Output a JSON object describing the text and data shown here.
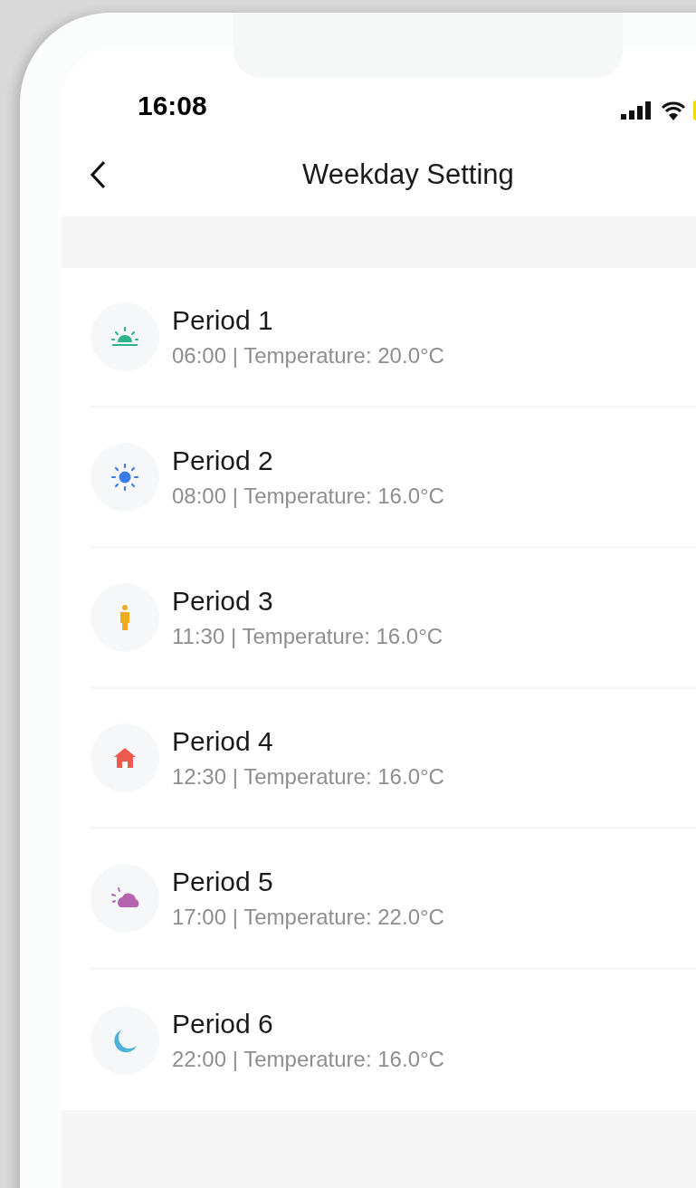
{
  "status_bar": {
    "time": "16:08"
  },
  "nav": {
    "title": "Weekday Setting"
  },
  "periods": [
    {
      "name": "Period 1",
      "detail": "06:00 | Temperature: 20.0°C",
      "kind": "sunrise",
      "color": "#2bb38a"
    },
    {
      "name": "Period 2",
      "detail": "08:00 | Temperature: 16.0°C",
      "kind": "sun",
      "color": "#3a7ce8"
    },
    {
      "name": "Period 3",
      "detail": "11:30 | Temperature: 16.0°C",
      "kind": "person",
      "color": "#f2ab1e"
    },
    {
      "name": "Period 4",
      "detail": "12:30 | Temperature: 16.0°C",
      "kind": "home",
      "color": "#ef5a4f"
    },
    {
      "name": "Period 5",
      "detail": "17:00 | Temperature: 22.0°C",
      "kind": "cloud",
      "color": "#b565b0"
    },
    {
      "name": "Period 6",
      "detail": "22:00 | Temperature: 16.0°C",
      "kind": "moon",
      "color": "#4fb3d9"
    }
  ]
}
